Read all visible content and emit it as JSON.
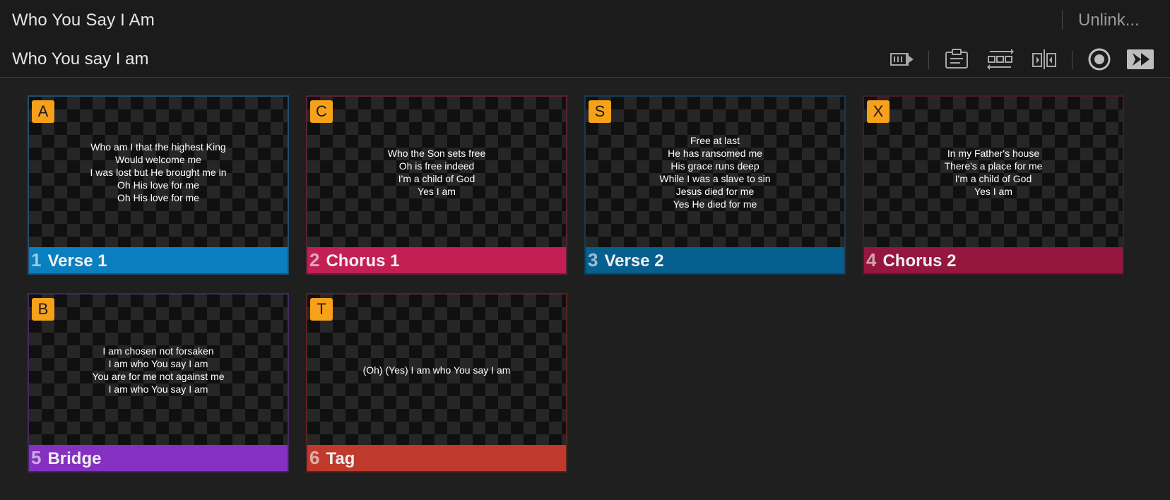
{
  "header": {
    "title": "Who You Say I Am",
    "subtitle": "Who You say I am",
    "unlink_label": "Unlink..."
  },
  "toolbar": {
    "icons": [
      "slide-advance-icon",
      "clipboard-icon",
      "arrangement-icon",
      "mirror-icon",
      "target-icon",
      "play-forward-icon"
    ]
  },
  "colors": {
    "verse": "#0a7fbf",
    "chorus": "#c41f55",
    "verse2": "#06608f",
    "chorus2": "#95163f",
    "bridge": "#8530c0",
    "tag": "#bf3a2c",
    "hotkey": "#f7a11a"
  },
  "slides": [
    {
      "number": "1",
      "name": "Verse 1",
      "hotkey": "A",
      "color": "#0a7fbf",
      "border": "#1f4f6e",
      "lines": [
        "Who am I that the highest King",
        "Would welcome me",
        "I was lost but He brought me in",
        "Oh His love for me",
        "Oh His love for me"
      ]
    },
    {
      "number": "2",
      "name": "Chorus 1",
      "hotkey": "C",
      "color": "#c41f55",
      "border": "#5a2235",
      "lines": [
        "Who the Son sets free",
        "Oh is free indeed",
        "I'm a child of God",
        "Yes I am"
      ]
    },
    {
      "number": "3",
      "name": "Verse 2",
      "hotkey": "S",
      "color": "#06608f",
      "border": "#173a52",
      "lines": [
        "Free at last",
        "He has ransomed me",
        "His grace runs deep",
        "While I was a slave to sin",
        "Jesus died for me",
        "Yes He died for me"
      ]
    },
    {
      "number": "4",
      "name": "Chorus 2",
      "hotkey": "X",
      "color": "#95163f",
      "border": "#4a1a2a",
      "lines": [
        "In my Father's house",
        "There's a place for me",
        "I'm a child of God",
        "Yes I am"
      ]
    },
    {
      "number": "5",
      "name": "Bridge",
      "hotkey": "B",
      "color": "#8530c0",
      "border": "#432860",
      "lines": [
        "I am chosen not forsaken",
        "I am who You say I am",
        "You are for me not against me",
        "I am who You say I am"
      ]
    },
    {
      "number": "6",
      "name": "Tag",
      "hotkey": "T",
      "color": "#bf3a2c",
      "border": "#5a2520",
      "lines": [
        "(Oh) (Yes) I am who You say I am"
      ]
    }
  ]
}
